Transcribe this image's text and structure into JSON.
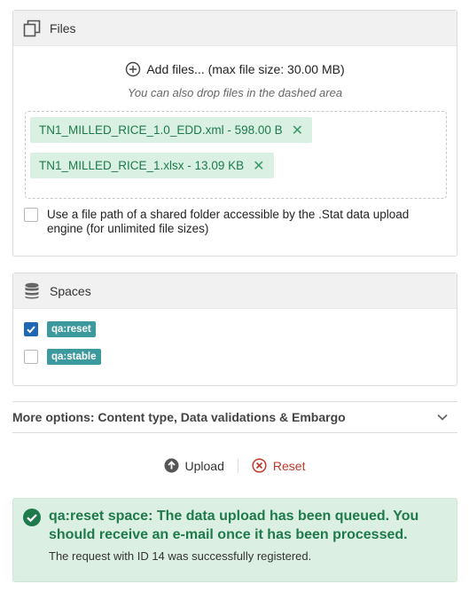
{
  "files_panel": {
    "title": "Files",
    "icon": "copy-icon",
    "add_files_label": "Add files... (max file size: 30.00 MB)",
    "drop_hint": "You can also drop files in the dashed area",
    "files": [
      {
        "label": "TN1_MILLED_RICE_1.0_EDD.xml - 598.00 B"
      },
      {
        "label": "TN1_MILLED_RICE_1.xlsx - 13.09 KB"
      }
    ],
    "shared_folder": {
      "label": "Use a file path of a shared folder accessible by the .Stat data upload engine (for unlimited file sizes)",
      "checked": false
    }
  },
  "spaces_panel": {
    "title": "Spaces",
    "icon": "database-icon",
    "spaces": [
      {
        "label": "qa:reset",
        "checked": true
      },
      {
        "label": "qa:stable",
        "checked": false
      }
    ]
  },
  "more_options": {
    "label": "More options: Content type, Data validations & Embargo"
  },
  "actions": {
    "upload_label": "Upload",
    "reset_label": "Reset"
  },
  "alert": {
    "title": "qa:reset space: The data upload has been queued. You should receive an e-mail once it has been processed.",
    "message": "The request with ID 14 was successfully registered."
  },
  "colors": {
    "chip_bg": "#d9f0e3",
    "chip_text": "#1e7a4b",
    "space_tag": "#3c9a9f",
    "checkbox_checked": "#1f68b6",
    "reset": "#c0392b",
    "alert_bg": "#dcefe3"
  }
}
